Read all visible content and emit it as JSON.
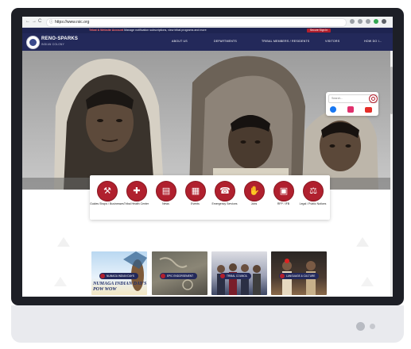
{
  "browser": {
    "url": "https://www.rsic.org",
    "back_glyph": "←",
    "forward_glyph": "→",
    "reload_glyph": "C"
  },
  "alert": {
    "label": "Tribal & Website Account",
    "message": "Manage notification subscriptions, view tribal programs and more",
    "signin": "Secure Sign In"
  },
  "site": {
    "name": "RENO-SPARKS",
    "subtitle": "INDIAN COLONY",
    "nav": [
      "ABOUT US",
      "DEPARTMENTS",
      "TRIBAL MEMBERS / RESIDENTS",
      "VISITORS",
      "HOW DO I..."
    ]
  },
  "search": {
    "placeholder": "Search..."
  },
  "social": {
    "facebook": "facebook-icon",
    "instagram": "instagram-icon",
    "youtube": "youtube-icon"
  },
  "quick_links": [
    {
      "label": "Guides Shops / Businesses",
      "icon": "tools-icon"
    },
    {
      "label": "Tribal Health Center",
      "icon": "health-icon"
    },
    {
      "label": "News",
      "icon": "news-icon"
    },
    {
      "label": "Events",
      "icon": "calendar-icon"
    },
    {
      "label": "Emergency Services",
      "icon": "emergency-icon"
    },
    {
      "label": "Jobs",
      "icon": "handshake-icon"
    },
    {
      "label": "RFP / IFB",
      "icon": "document-icon"
    },
    {
      "label": "Legal / Public Notices",
      "icon": "gavel-icon"
    }
  ],
  "cards": [
    {
      "label": "NUMAGA INDIAN DAYS",
      "caption": "NUMAGA INDIAN DAY'S POW WOW"
    },
    {
      "label": "EPIC ENDORSEMENT",
      "caption": ""
    },
    {
      "label": "TRIBAL COUNCIL",
      "caption": ""
    },
    {
      "label": "LANGUAGE & CULTURE",
      "caption": ""
    }
  ],
  "colors": {
    "navy": "#23295a",
    "accent_red": "#b0202e",
    "alert_bg": "#1e2451"
  }
}
